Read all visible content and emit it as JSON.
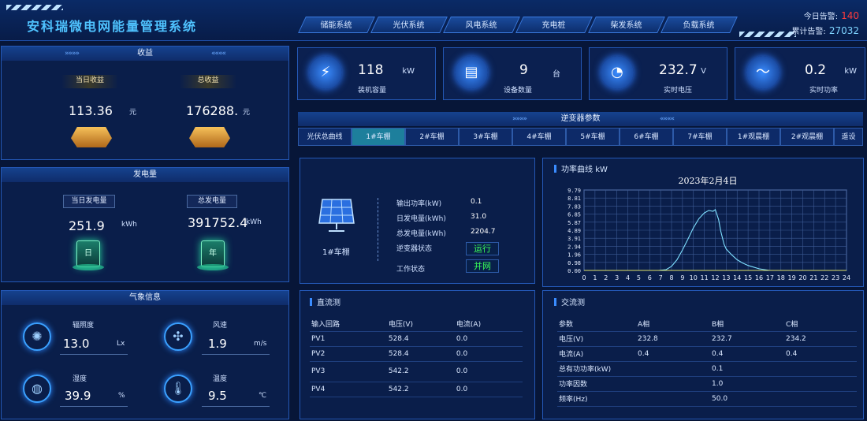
{
  "header": {
    "title": "安科瑞微电网能量管理系统",
    "tabs": [
      "储能系统",
      "光伏系统",
      "风电系统",
      "充电桩",
      "柴发系统",
      "负载系统"
    ],
    "alarm_today_label": "今日告警:",
    "alarm_today": "140",
    "alarm_total_label": "累计告警:",
    "alarm_total": "27032"
  },
  "income": {
    "title": "收益",
    "today_label": "当日收益",
    "today_value": "113.36",
    "today_unit": "元",
    "total_label": "总收益",
    "total_value": "176288.",
    "total_unit": "元"
  },
  "generation": {
    "title": "发电量",
    "today_label": "当日发电量",
    "today_value": "251.9",
    "today_unit": "kWh",
    "today_icon": "日",
    "total_label": "总发电量",
    "total_value": "391752.4",
    "total_unit": "kWh",
    "total_icon": "年"
  },
  "weather": {
    "title": "气象信息",
    "irr_label": "辐照度",
    "irr_value": "13.0",
    "irr_unit": "Lx",
    "wind_label": "风速",
    "wind_value": "1.9",
    "wind_unit": "m/s",
    "hum_label": "湿度",
    "hum_value": "39.9",
    "hum_unit": "%",
    "temp_label": "温度",
    "temp_value": "9.5",
    "temp_unit": "℃"
  },
  "cards": [
    {
      "value": "118",
      "unit": "kW",
      "label": "装机容量",
      "icon": "solar-icon"
    },
    {
      "value": "9",
      "unit": "台",
      "label": "设备数量",
      "icon": "device-icon"
    },
    {
      "value": "232.7",
      "unit": "V",
      "label": "实时电压",
      "icon": "gauge-icon"
    },
    {
      "value": "0.2",
      "unit": "kW",
      "label": "实时功率",
      "icon": "power-icon"
    }
  ],
  "inverter": {
    "title": "逆变器参数",
    "tabs": [
      "光伏总曲线",
      "1#车棚",
      "2#车棚",
      "3#车棚",
      "4#车棚",
      "5#车棚",
      "6#车棚",
      "7#车棚",
      "1#观晨棚",
      "2#观晨棚",
      "遥设"
    ],
    "device_name": "1#车棚",
    "out_power_label": "输出功率(kW)",
    "out_power": "0.1",
    "day_gen_label": "日发电量(kWh)",
    "day_gen": "31.0",
    "total_gen_label": "总发电量(kWh)",
    "total_gen": "2204.7",
    "inv_status_label": "逆变器状态",
    "inv_status": "运行",
    "work_status_label": "工作状态",
    "work_status": "并网"
  },
  "chart_panel": {
    "title": "功率曲线",
    "unit": "kW"
  },
  "chart_data": {
    "type": "line",
    "title": "2023年2月4日",
    "xlabel": "",
    "ylabel": "",
    "yticks": [
      "9.79",
      "8.81",
      "7.83",
      "6.85",
      "5.87",
      "4.89",
      "3.91",
      "2.94",
      "1.96",
      "0.98",
      "0.00"
    ],
    "ylim": [
      0,
      9.79
    ],
    "xlim": [
      0,
      24
    ],
    "xticks": [
      0,
      1,
      2,
      3,
      4,
      5,
      6,
      7,
      8,
      9,
      10,
      11,
      12,
      13,
      14,
      15,
      16,
      17,
      18,
      19,
      20,
      21,
      22,
      23,
      24
    ],
    "series": [
      {
        "color": "#7fe0ff",
        "x": [
          0,
          6.8,
          7.5,
          8,
          8.5,
          9,
          9.5,
          10,
          10.5,
          11,
          11.4,
          11.8,
          12,
          12.3,
          12.5,
          12.8,
          13,
          13.5,
          14,
          14.5,
          15,
          15.5,
          16,
          16.5,
          17,
          24
        ],
        "y": [
          0,
          0,
          0.1,
          0.5,
          1.3,
          2.5,
          3.8,
          5.2,
          6.3,
          7.0,
          7.3,
          7.2,
          7.4,
          6.2,
          4.8,
          3.2,
          2.6,
          1.9,
          1.3,
          0.9,
          0.6,
          0.4,
          0.2,
          0.1,
          0,
          0
        ]
      },
      {
        "color": "#e0e36a",
        "x": [
          0,
          24
        ],
        "y": [
          0,
          0
        ]
      }
    ],
    "grid": true
  },
  "dc": {
    "title": "直流测",
    "headers": [
      "输入回路",
      "电压(V)",
      "电流(A)"
    ],
    "rows": [
      [
        "PV1",
        "528.4",
        "0.0"
      ],
      [
        "PV2",
        "528.4",
        "0.0"
      ],
      [
        "PV3",
        "542.2",
        "0.0"
      ],
      [
        "PV4",
        "542.2",
        "0.0"
      ]
    ]
  },
  "ac": {
    "title": "交流测",
    "headers": [
      "参数",
      "A相",
      "B相",
      "C相"
    ],
    "rows": [
      [
        "电压(V)",
        "232.8",
        "232.7",
        "234.2"
      ],
      [
        "电流(A)",
        "0.4",
        "0.4",
        "0.4"
      ],
      [
        "总有功功率(kW)",
        "",
        "0.1",
        ""
      ],
      [
        "功率因数",
        "",
        "1.0",
        ""
      ],
      [
        "频率(Hz)",
        "",
        "50.0",
        ""
      ]
    ]
  }
}
